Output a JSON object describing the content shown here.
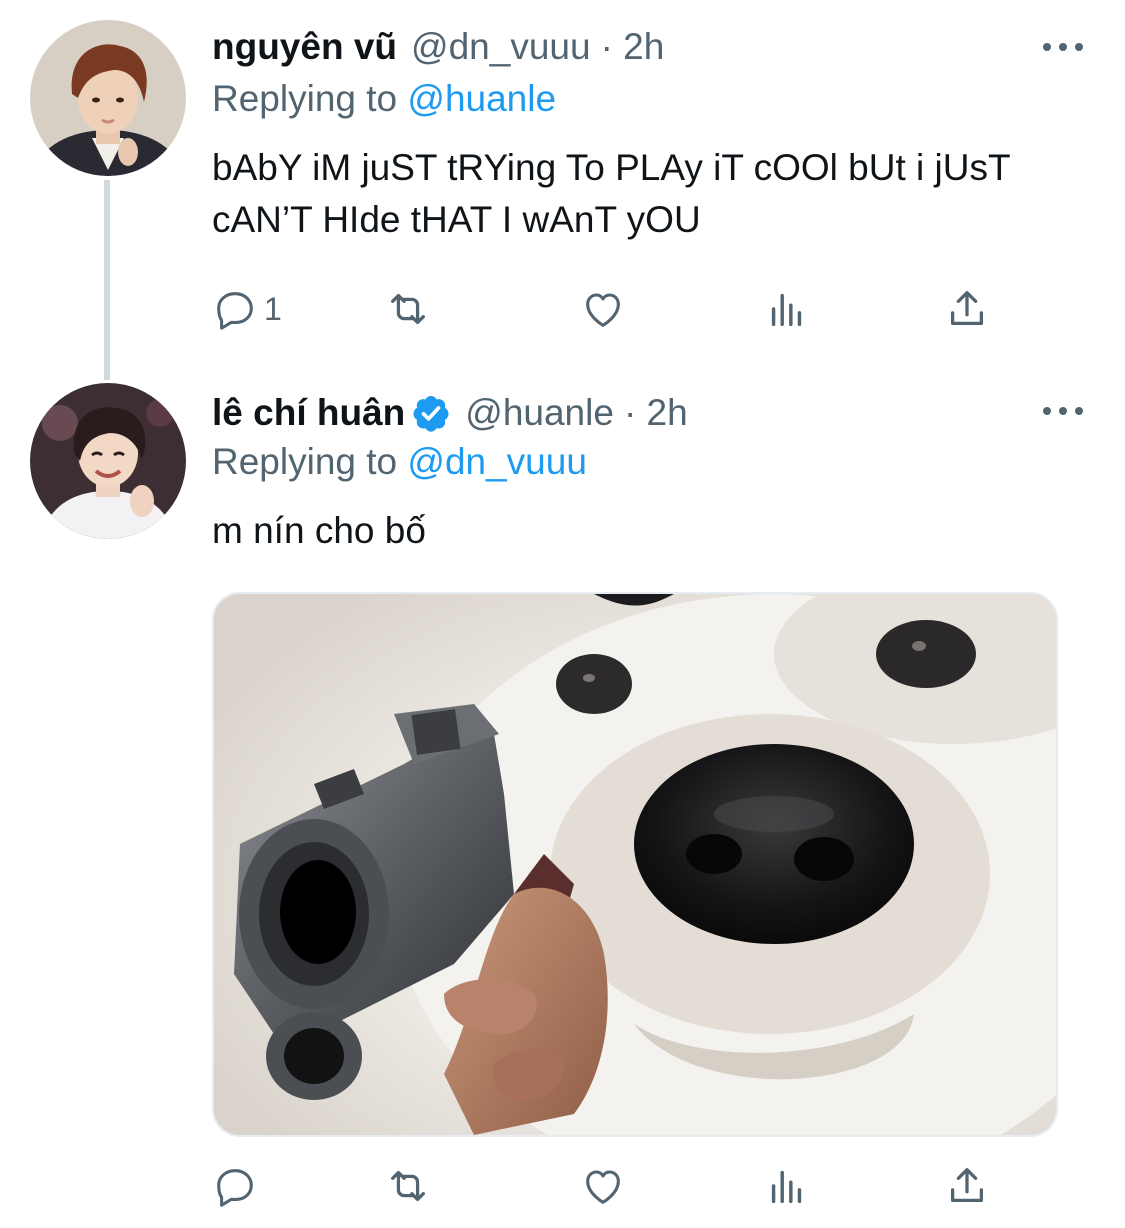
{
  "tweets": [
    {
      "author_name": "nguyên vũ",
      "handle": "@dn_vuuu",
      "time": "· 2h",
      "replying_prefix": "Replying to",
      "replying_to": "@huanle",
      "text": "bAbY iM juST tRYing To PLAy iT cOOl bUt i jUsT cAN’T HIde tHAT I wAnT yOU",
      "reply_count": "1",
      "icons": [
        "reply-icon",
        "retweet-icon",
        "like-icon",
        "analytics-icon",
        "share-icon",
        "more-icon"
      ]
    },
    {
      "author_name": "lê chí huân",
      "verified": true,
      "handle": "@huanle",
      "time": "· 2h",
      "replying_prefix": "Replying to",
      "replying_to": "@dn_vuuu",
      "text": "m nín cho bố",
      "media": "photo of a white samoyed dog's face with a hand pointing a handgun at the viewer",
      "icons": [
        "reply-icon",
        "retweet-icon",
        "like-icon",
        "analytics-icon",
        "share-icon",
        "more-icon"
      ]
    }
  ],
  "colors": {
    "accent": "#1d9bf0",
    "secondary_text": "#536471",
    "primary_text": "#0f1419",
    "thread_line": "#cfd9de"
  }
}
